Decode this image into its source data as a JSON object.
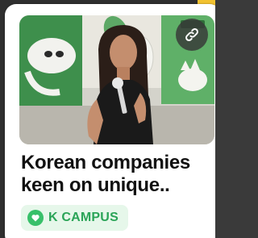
{
  "card": {
    "title": "Korean companies keen on unique..",
    "source_label": "K CAMPUS"
  },
  "icons": {
    "link": "link-icon",
    "source": "heart-icon"
  },
  "colors": {
    "badge_bg": "#e6f7ea",
    "badge_text": "#2aa457",
    "badge_icon": "#38c06a",
    "peek_card": "#f2c230"
  }
}
